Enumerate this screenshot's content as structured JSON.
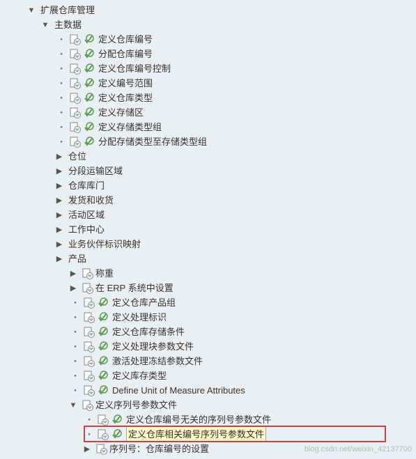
{
  "tree": {
    "root": "扩展仓库管理",
    "master_data": "主数据",
    "items_a": [
      "定义仓库编号",
      "分配仓库编号",
      "定义仓库编号控制",
      "定义编号范围",
      "定义仓库类型",
      "定义存储区",
      "定义存储类型组",
      "分配存储类型至存储类型组"
    ],
    "items_b": [
      "仓位",
      "分段运输区域",
      "仓库库门",
      "发货和收货",
      "活动区域",
      "工作中心",
      "业务伙伴标识映射",
      "产品"
    ],
    "items_c_first": [
      "称重",
      "在 ERP 系统中设置"
    ],
    "items_c": [
      "定义仓库产品组",
      "定义处理标识",
      "定义仓库存储条件",
      "定义处理块参数文件",
      "激活处理冻结参数文件",
      "定义库存类型",
      "Define Unit of Measure Attributes"
    ],
    "seq_parent": "定义序列号参数文件",
    "seq_items": [
      "定义仓库编号无关的序列号参数文件",
      "定义仓库相关编号序列号参数文件",
      "序列号：仓库编号的设置"
    ]
  },
  "watermark": "blog.csdn.net/weixin_42137700"
}
